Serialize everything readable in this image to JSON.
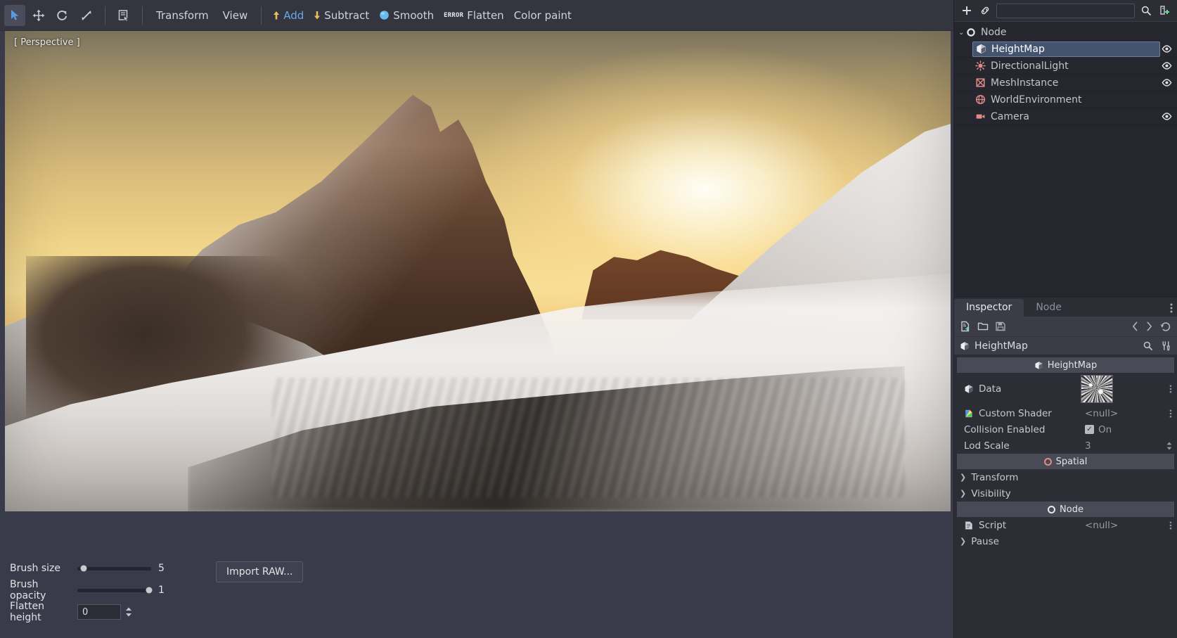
{
  "toolbar": {
    "transform_tools": [
      {
        "name": "select-tool",
        "icon": "cursor-arrow-icon",
        "active": true
      },
      {
        "name": "move-tool",
        "icon": "move-arrows-icon",
        "active": false
      },
      {
        "name": "rotate-tool",
        "icon": "rotate-arrow-icon",
        "active": false
      },
      {
        "name": "scale-tool",
        "icon": "scale-arrow-icon",
        "active": false
      }
    ],
    "list_select_icon": "list-select-icon",
    "menus": [
      {
        "label": "Transform"
      },
      {
        "label": "View"
      }
    ],
    "brush_modes": [
      {
        "label": "Add",
        "icon": "arrow-up-icon",
        "active": true
      },
      {
        "label": "Subtract",
        "icon": "arrow-down-icon",
        "active": false
      },
      {
        "label": "Smooth",
        "icon": "blue-sphere-icon",
        "active": false
      },
      {
        "label": "Flatten",
        "icon": "error-badge-icon",
        "active": false,
        "badge": "ERROR"
      },
      {
        "label": "Color paint",
        "icon": "",
        "active": false
      }
    ]
  },
  "viewport": {
    "label": "[ Perspective ]"
  },
  "brush_panel": {
    "rows": [
      {
        "label": "Brush size",
        "value": "5",
        "knob_percent": 9
      },
      {
        "label": "Brush opacity",
        "value": "1",
        "knob_percent": 97
      }
    ],
    "flatten": {
      "label": "Flatten height",
      "value": "0"
    },
    "import_button": "Import RAW..."
  },
  "scene_dock": {
    "add_node_icon": "plus-icon",
    "instance_icon": "link-chain-icon",
    "filter_value": "",
    "filter_placeholder": "",
    "search_icon": "search-icon",
    "tree_options_icon": "node-tree-options-icon",
    "tree": {
      "root": {
        "label": "Node",
        "icon": "node-circle-icon",
        "expanded": true,
        "caret": "⌄"
      },
      "children": [
        {
          "label": "HeightMap",
          "icon": "spatial-cube-icon",
          "selected": true,
          "visible_toggle": true
        },
        {
          "label": "DirectionalLight",
          "icon": "light-sun-icon",
          "selected": false,
          "visible_toggle": true
        },
        {
          "label": "MeshInstance",
          "icon": "mesh-instance-icon",
          "selected": false,
          "visible_toggle": true
        },
        {
          "label": "WorldEnvironment",
          "icon": "world-globe-icon",
          "selected": false,
          "visible_toggle": false
        },
        {
          "label": "Camera",
          "icon": "camera-icon",
          "selected": false,
          "visible_toggle": true
        }
      ]
    }
  },
  "inspector": {
    "tabs": [
      {
        "label": "Inspector",
        "active": true
      },
      {
        "label": "Node",
        "active": false
      }
    ],
    "more_icon": "vertical-dots-icon",
    "toolbar_icons": [
      {
        "name": "new-resource-icon"
      },
      {
        "name": "open-resource-icon"
      },
      {
        "name": "save-resource-icon"
      },
      {
        "name": "history-prev-icon"
      },
      {
        "name": "history-next-icon"
      },
      {
        "name": "history-revert-icon"
      }
    ],
    "header": {
      "title": "HeightMap",
      "icon": "spatial-cube-icon",
      "search_icon": "search-icon",
      "tools_icon": "object-tools-icon"
    },
    "sections": [
      {
        "type": "category",
        "label": "HeightMap",
        "icon": "spatial-cube-icon"
      },
      {
        "type": "property",
        "label": "Data",
        "icon": "spatial-cube-icon",
        "value": "",
        "control": "thumbnail",
        "menu": "vertical-dots-icon"
      },
      {
        "type": "property",
        "label": "Custom Shader",
        "icon": "shader-file-icon",
        "value": "<null>",
        "control": "text",
        "menu": "vertical-dots-icon"
      },
      {
        "type": "property",
        "label": "Collision Enabled",
        "icon": "",
        "value": "On",
        "control": "checkbox",
        "checked": true,
        "menu": ""
      },
      {
        "type": "property",
        "label": "Lod Scale",
        "icon": "",
        "value": "3",
        "control": "spinner",
        "menu": ""
      },
      {
        "type": "category",
        "label": "Spatial",
        "icon": "spatial-circle-icon"
      },
      {
        "type": "fold",
        "label": "Transform",
        "expanded": false
      },
      {
        "type": "fold",
        "label": "Visibility",
        "expanded": false
      },
      {
        "type": "category",
        "label": "Node",
        "icon": "node-circle-icon"
      },
      {
        "type": "property",
        "label": "Script",
        "icon": "script-file-icon",
        "value": "<null>",
        "control": "text",
        "menu": "vertical-dots-icon"
      },
      {
        "type": "fold",
        "label": "Pause",
        "expanded": false
      }
    ]
  },
  "colors": {
    "accent_blue": "#6ba8e8",
    "selection_blue": "#44546e",
    "node_icon_pink": "#e08a8a",
    "panel_bg": "#3a3b4a",
    "dock_bg": "#2c2d35",
    "tree_bg": "#26272e",
    "arrow_yellow": "#e8c05a"
  }
}
